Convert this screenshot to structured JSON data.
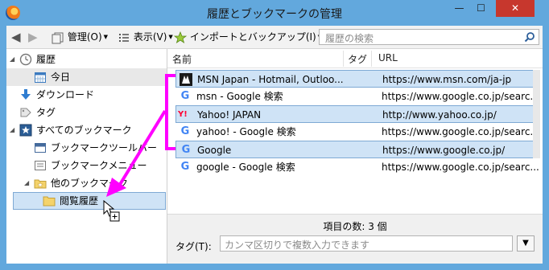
{
  "window": {
    "title": "履歴とブックマークの管理",
    "min": "—",
    "max": "☐",
    "close": "✕"
  },
  "toolbar": {
    "back": "◀",
    "forward": "▶",
    "manage_label": "管理(O)",
    "view_label": "表示(V)",
    "import_label": "インポートとバックアップ(I)",
    "search_placeholder": "履歴の検索"
  },
  "sidebar": {
    "items": [
      {
        "label": "履歴",
        "icon": "clock-icon"
      },
      {
        "label": "今日",
        "icon": "calendar-icon"
      },
      {
        "label": "ダウンロード",
        "icon": "download-icon"
      },
      {
        "label": "タグ",
        "icon": "tag-icon"
      },
      {
        "label": "すべてのブックマーク",
        "icon": "star-folder-icon"
      },
      {
        "label": "ブックマークツールバー",
        "icon": "toolbar-icon"
      },
      {
        "label": "ブックマークメニュー",
        "icon": "menu-icon"
      },
      {
        "label": "他のブックマーク",
        "icon": "folder-star-icon"
      },
      {
        "label": "閲覧履歴",
        "icon": "folder-icon"
      }
    ]
  },
  "columns": {
    "name": "名前",
    "tag": "タグ",
    "url": "URL"
  },
  "rows": [
    {
      "name": "MSN Japan - Hotmail, Outloo...",
      "url": "https://www.msn.com/ja-jp",
      "icon": "msn-icon",
      "selected": true
    },
    {
      "name": "msn - Google 検索",
      "url": "https://www.google.co.jp/searc...",
      "icon": "google-icon",
      "selected": false
    },
    {
      "name": "Yahoo! JAPAN",
      "url": "http://www.yahoo.co.jp/",
      "icon": "yahoo-icon",
      "selected": true
    },
    {
      "name": "yahoo! - Google 検索",
      "url": "https://www.google.co.jp/searc...",
      "icon": "google-icon",
      "selected": false
    },
    {
      "name": "Google",
      "url": "https://www.google.co.jp/",
      "icon": "google-icon",
      "selected": true
    },
    {
      "name": "google - Google 検索",
      "url": "https://www.google.co.jp/searc...",
      "icon": "google-icon",
      "selected": false
    }
  ],
  "footer": {
    "count": "項目の数: 3 個",
    "tag_label": "タグ(T):",
    "tag_placeholder": "カンマ区切りで複数入力できます",
    "tag_drop": "▼"
  },
  "colors": {
    "titlebar": "#62a8dd",
    "selection": "#cfe3f6",
    "annotation": "#ff00ff",
    "close": "#c7372d"
  },
  "icons": {
    "yahoo_mark": "Y!",
    "google_mark": "G"
  }
}
